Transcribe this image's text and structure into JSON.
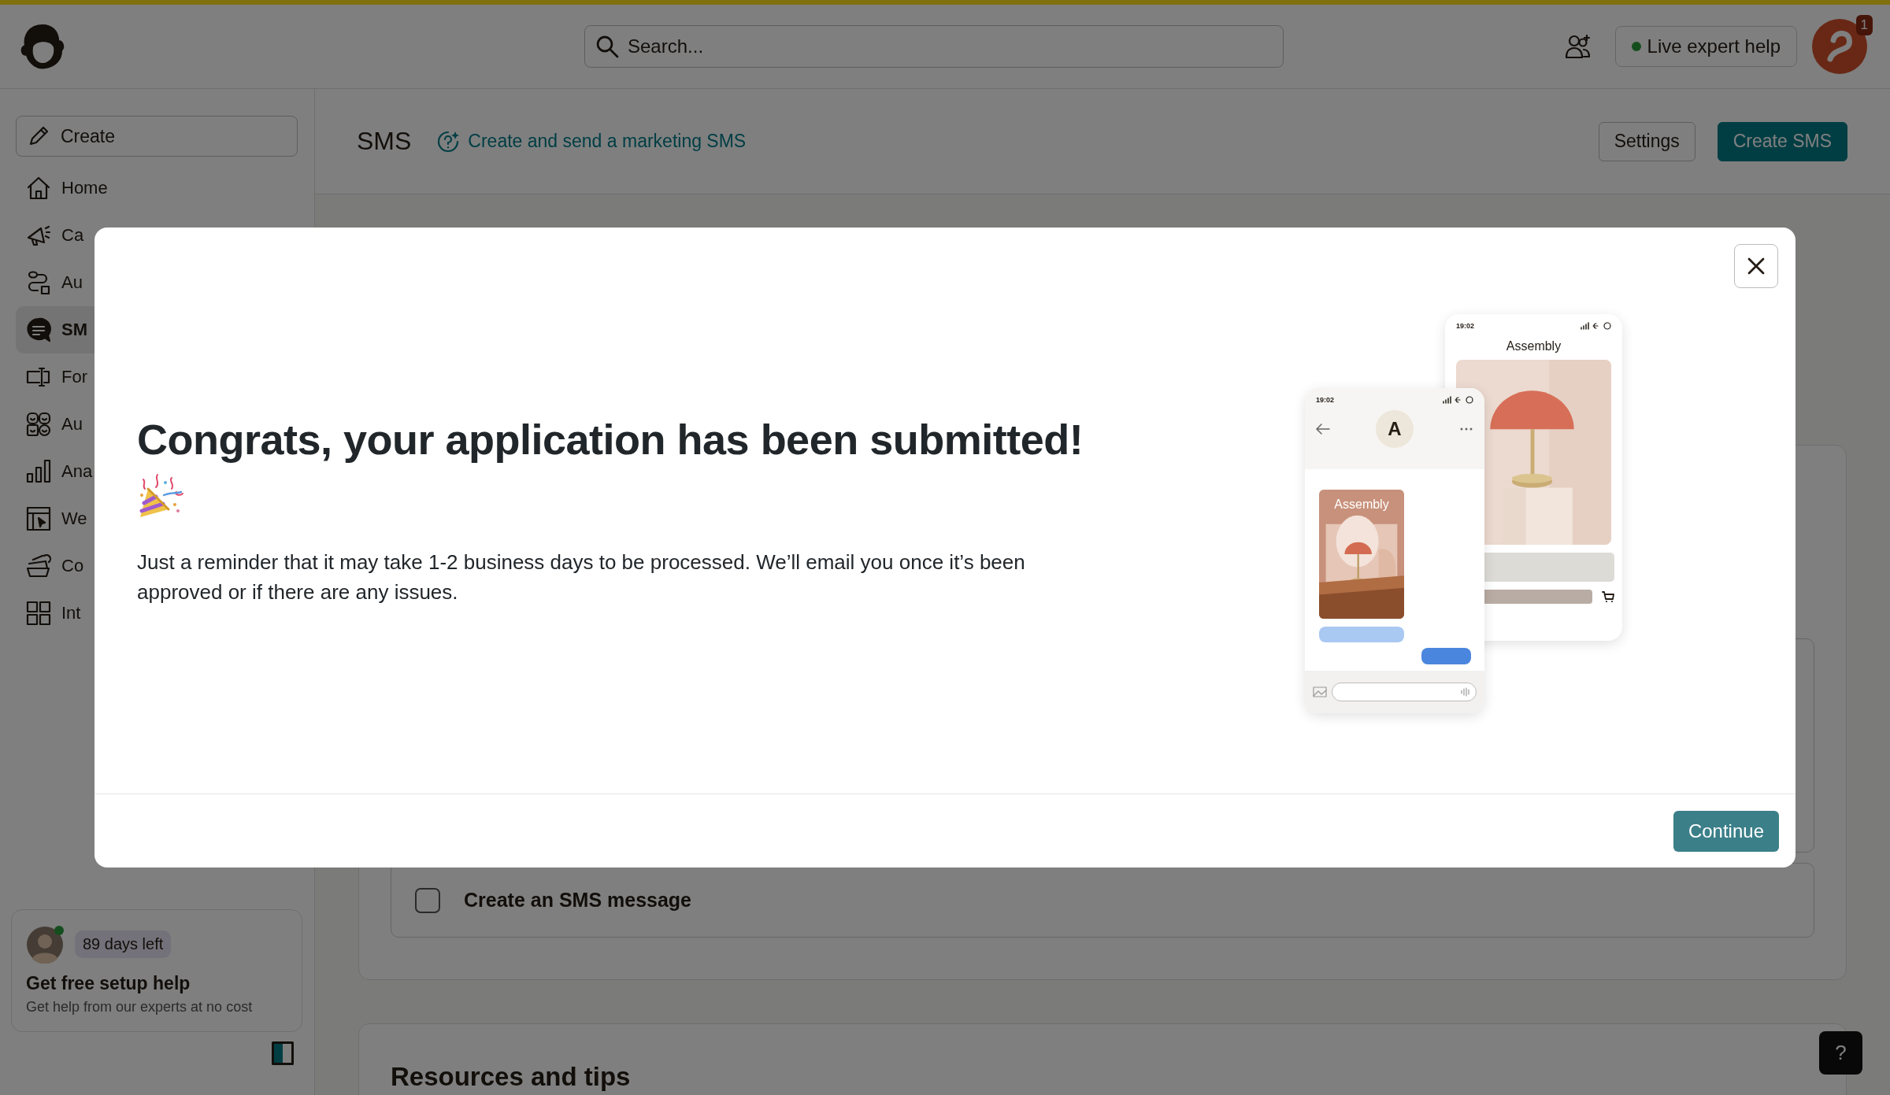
{
  "top_bar": {
    "search": {
      "placeholder": "Search..."
    },
    "help_button": "Live expert help",
    "notification_count": "1"
  },
  "sidebar": {
    "create_button": "Create",
    "items": [
      {
        "label": "Home",
        "selected": false
      },
      {
        "label": "Ca",
        "selected": false
      },
      {
        "label": "Au",
        "selected": false
      },
      {
        "label": "SM",
        "selected": true
      },
      {
        "label": "For",
        "selected": false
      },
      {
        "label": "Au",
        "selected": false
      },
      {
        "label": "Ana",
        "selected": false
      },
      {
        "label": "We",
        "selected": false
      },
      {
        "label": "Co",
        "selected": false
      },
      {
        "label": "Int",
        "selected": false
      }
    ],
    "trial_card": {
      "badge": "89 days left",
      "title": "Get free setup help",
      "subtitle": "Get help from our experts at no cost"
    }
  },
  "page_header": {
    "title": "SMS",
    "subtitle_link": "Create and send a marketing SMS",
    "buttons": [
      {
        "label": "Settings",
        "kind": "secondary"
      },
      {
        "label": "Create SMS",
        "kind": "primary"
      }
    ]
  },
  "checklist": [
    {
      "label": "Create an SMS message",
      "checked": false
    }
  ],
  "resources": {
    "title": "Resources and tips"
  },
  "help_fab": "?",
  "modal": {
    "title": "Congrats, your application has been submitted!",
    "body": "Just a reminder that it may take 1-2 business days to be processed. We’ll email you once it’s been approved or if there are any issues.",
    "button": "Continue",
    "illustration": {
      "back_phone": {
        "time": "19:02",
        "title": "Assembly"
      },
      "front_phone": {
        "time": "19:02",
        "avatar": "A",
        "card_title": "Assembly"
      }
    }
  }
}
